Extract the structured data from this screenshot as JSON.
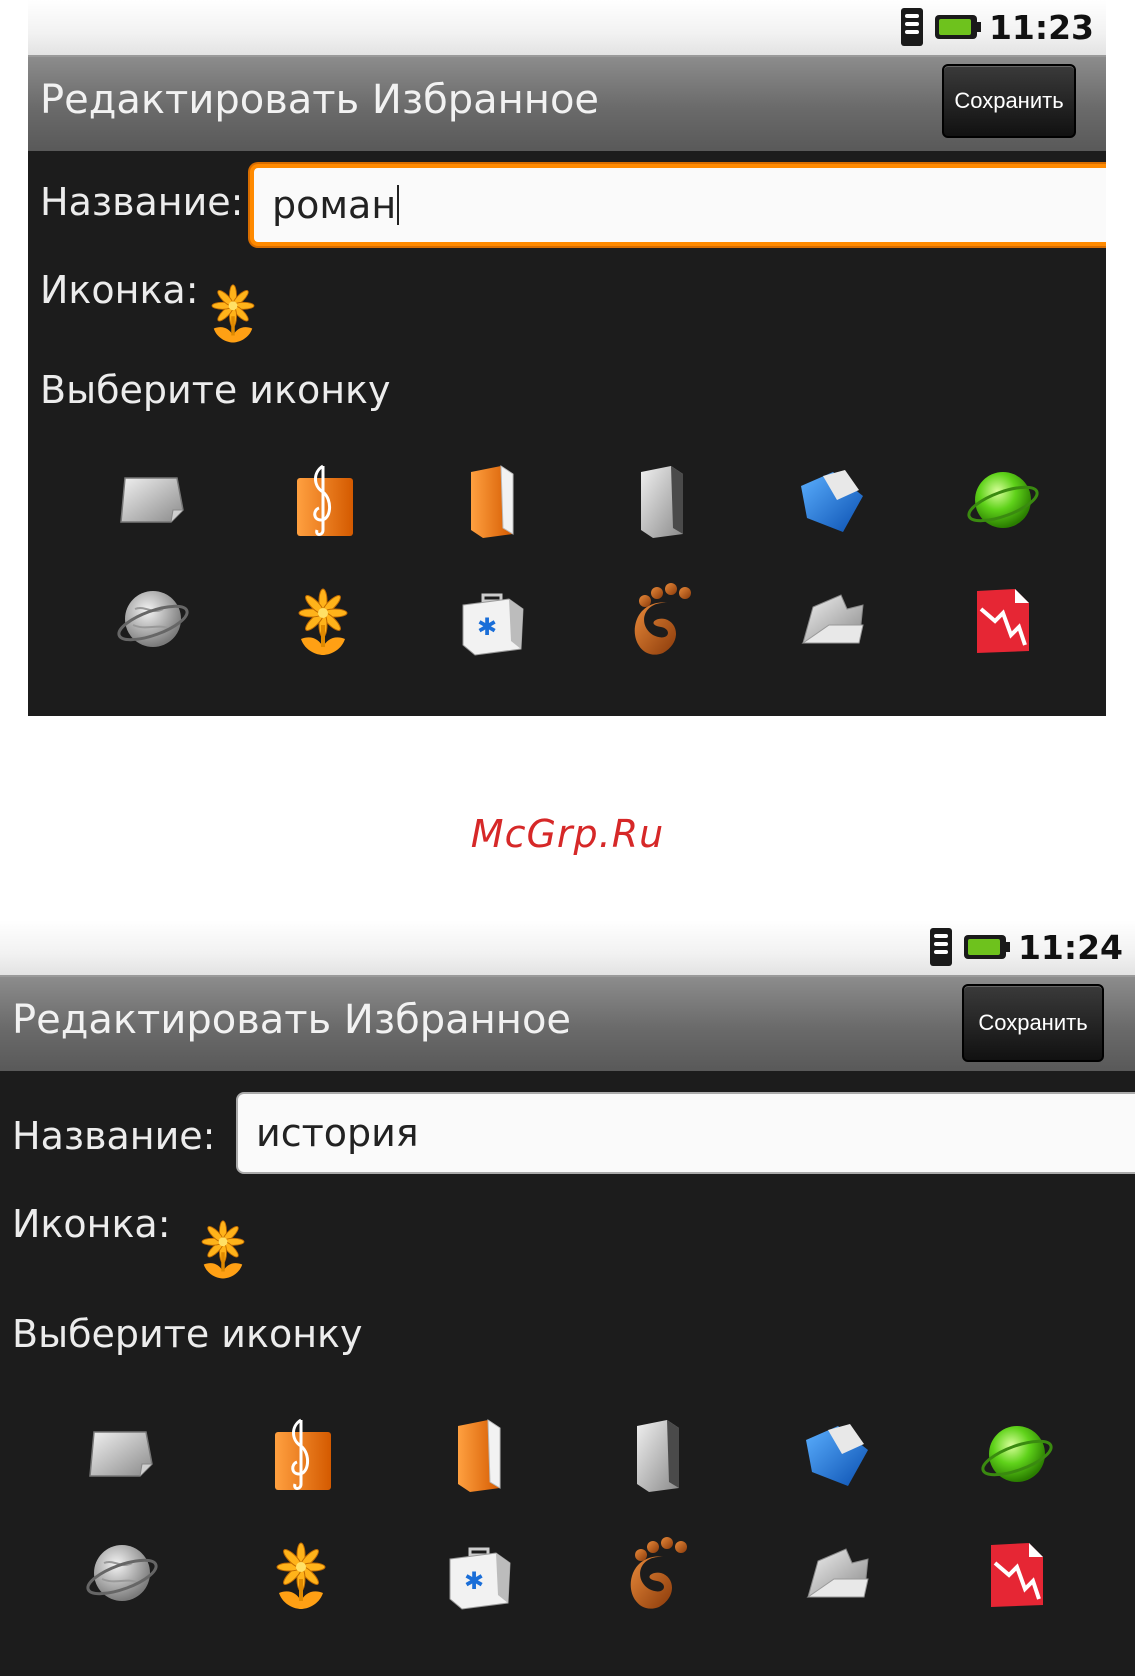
{
  "screens": [
    {
      "status": {
        "time": "11:23"
      },
      "title": "Редактировать Избранное",
      "save_label": "Сохранить",
      "name_label": "Название:",
      "name_value": "роман",
      "icon_label": "Иконка:",
      "choose_label": "Выберите иконку"
    },
    {
      "status": {
        "time": "11:24"
      },
      "title": "Редактировать Избранное",
      "save_label": "Сохранить",
      "name_label": "Название:",
      "name_value": "история",
      "icon_label": "Иконка:",
      "choose_label": "Выберите иконку"
    }
  ],
  "icons": [
    "folder-grey-icon",
    "music-icon",
    "book-orange-icon",
    "book-grey-icon",
    "folder-blue-icon",
    "globe-green-icon",
    "globe-grey-icon",
    "flower-icon",
    "bag-icon",
    "gnome-foot-icon",
    "folder-open-icon",
    "pdf-icon"
  ],
  "watermark": "McGrp.Ru",
  "colors": {
    "focus": "#ff8a00",
    "watermark": "#d62828",
    "background": "#1c1c1c"
  }
}
